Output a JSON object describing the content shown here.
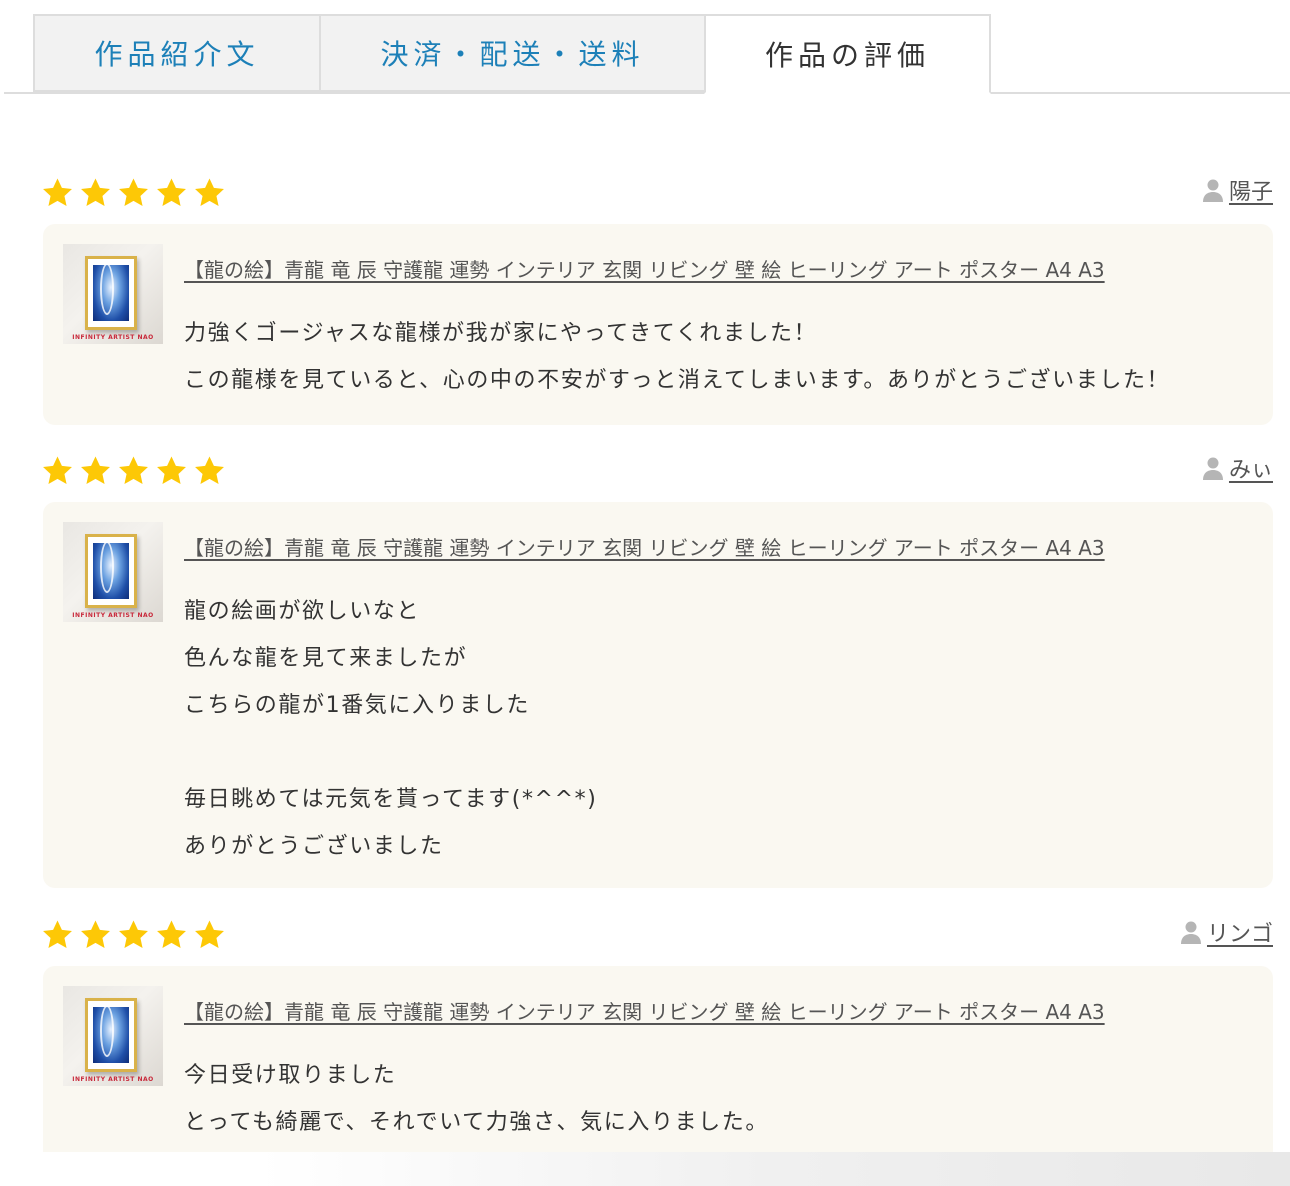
{
  "tabs": [
    {
      "label": "作品紹介文",
      "active": false
    },
    {
      "label": "決済・配送・送料",
      "active": false
    },
    {
      "label": "作品の評価",
      "active": true
    }
  ],
  "colors": {
    "tab_link": "#1d80b8",
    "star": "#fdc806",
    "card_bg": "#faf8f1"
  },
  "thumbnail_caption": "INFINITY ARTIST NAO",
  "reviews": [
    {
      "rating": 5,
      "reviewer": "陽子",
      "product_title": "【龍の絵】青龍 竜 辰 守護龍 運勢 インテリア 玄関 リビング 壁 絵 ヒーリング アート ポスター A4 A3",
      "comment": "力強くゴージャスな龍様が我が家にやってきてくれました！\nこの龍様を見ていると、心の中の不安がすっと消えてしまいます。ありがとうございました！"
    },
    {
      "rating": 5,
      "reviewer": "みぃ",
      "product_title": "【龍の絵】青龍 竜 辰 守護龍 運勢 インテリア 玄関 リビング 壁 絵 ヒーリング アート ポスター A4 A3",
      "comment": "龍の絵画が欲しいなと\n色んな龍を見て来ましたが\nこちらの龍が1番気に入りました\n\n毎日眺めては元気を貰ってます(*^^*)\nありがとうございました"
    },
    {
      "rating": 5,
      "reviewer": "リンゴ",
      "product_title": "【龍の絵】青龍 竜 辰 守護龍 運勢 インテリア 玄関 リビング 壁 絵 ヒーリング アート ポスター A4 A3",
      "comment": "今日受け取りました\nとっても綺麗で、それでいて力強さ、気に入りました。"
    }
  ]
}
